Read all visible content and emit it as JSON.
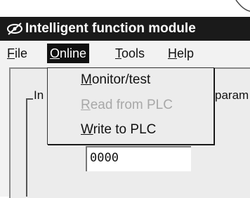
{
  "window": {
    "title": "Intelligent function module"
  },
  "menubar": {
    "items": [
      {
        "first": "F",
        "rest": "ile"
      },
      {
        "first": "O",
        "rest": "nline"
      },
      {
        "first": "T",
        "rest": "ools"
      },
      {
        "first": "H",
        "rest": "elp"
      }
    ]
  },
  "online_menu": {
    "items": [
      {
        "first": "M",
        "rest": "onitor/test",
        "enabled": true
      },
      {
        "first": "R",
        "rest": "ead from PLC",
        "enabled": false
      },
      {
        "first": "W",
        "rest": "rite to PLC",
        "enabled": true
      }
    ]
  },
  "panel": {
    "group_label_left": "In",
    "group_label_right": "param"
  },
  "field": {
    "value": "0000"
  },
  "colors": {
    "titlebar": "#1a1a1a",
    "menu_highlight": "#111111",
    "disabled_text": "#a8a8a8"
  }
}
